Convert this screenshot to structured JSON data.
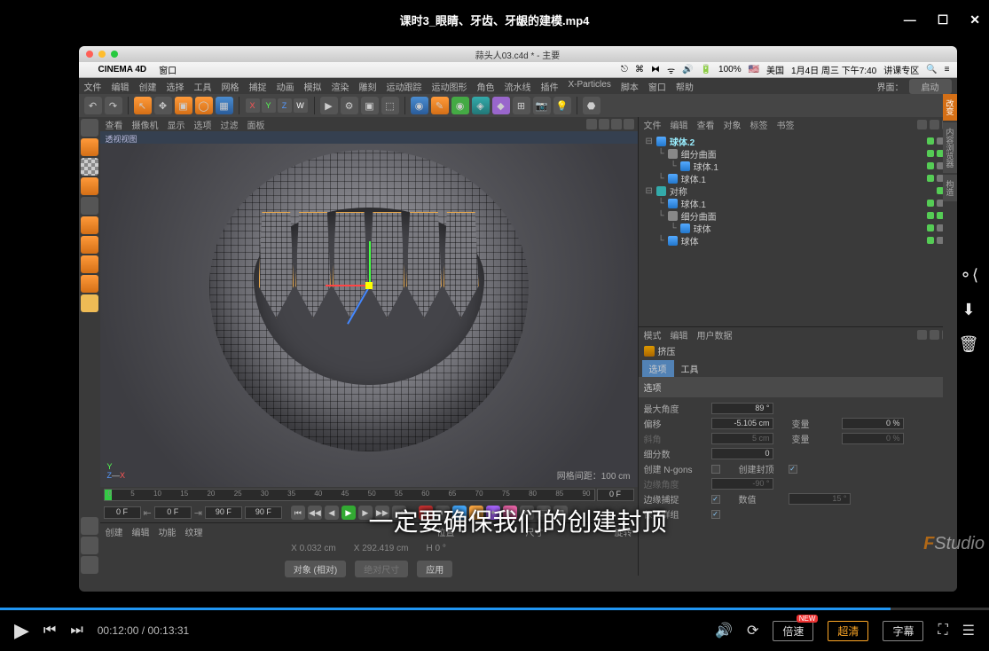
{
  "player": {
    "title": "课时3_眼睛、牙齿、牙龈的建模.mp4",
    "time_current": "00:12:00",
    "time_total": "00:13:31",
    "speed_label": "倍速",
    "quality_label": "超清",
    "subtitle_label": "字幕",
    "new_badge": "NEW",
    "subtitle_text": "一定要确保我们的创建封顶"
  },
  "mac": {
    "app": "CINEMA 4D",
    "menu": "窗口",
    "right": [
      "美国",
      "1月4日 周三 下午7:40",
      "讲课专区"
    ],
    "battery": "100%"
  },
  "window_title": "蒜头人03.c4d * - 主要",
  "c4d_menu": [
    "文件",
    "编辑",
    "创建",
    "选择",
    "工具",
    "网格",
    "捕捉",
    "动画",
    "模拟",
    "渲染",
    "雕刻",
    "运动跟踪",
    "运动图形",
    "角色",
    "流水线",
    "插件",
    "X-Particles",
    "脚本",
    "窗口",
    "帮助"
  ],
  "layout_label": "界面：",
  "layout_value": "启动",
  "axis": {
    "x": "X",
    "y": "Y",
    "z": "Z",
    "w": "W"
  },
  "viewport": {
    "menu": [
      "查看",
      "摄像机",
      "显示",
      "选项",
      "过滤",
      "面板"
    ],
    "label": "透视视图",
    "grid_info": "网格间距：100 cm"
  },
  "timeline": {
    "in1": "0 F",
    "in2": "0 F",
    "in3": "90 F",
    "in4": "90 F",
    "start": "0",
    "end": "90",
    "ticks": [
      "0",
      "5",
      "10",
      "15",
      "20",
      "25",
      "30",
      "35",
      "40",
      "45",
      "50",
      "55",
      "60",
      "65",
      "70",
      "75",
      "80",
      "85",
      "90"
    ],
    "end_label": "0 F"
  },
  "bottom_tabs": [
    "创建",
    "编辑",
    "功能",
    "纹理"
  ],
  "coord_headers": [
    "位置",
    "尺寸",
    "旋转"
  ],
  "coord_vals": {
    "x": "X 0.032 cm",
    "xw": "X 292.419 cm",
    "h": "H 0 °"
  },
  "apply_btns": {
    "mode": "对象 (相对)",
    "abs": "绝对尺寸",
    "apply": "应用"
  },
  "objmgr": {
    "tabs": [
      "文件",
      "编辑",
      "查看",
      "对象",
      "标签",
      "书签"
    ],
    "items": [
      {
        "indent": 0,
        "icon": "blue",
        "name": "球体.2",
        "current": true,
        "dots": [
          "g",
          "gr",
          "chk"
        ]
      },
      {
        "indent": 1,
        "icon": "grey",
        "name": "细分曲面",
        "dots": [
          "g",
          "g",
          "chk"
        ]
      },
      {
        "indent": 2,
        "icon": "blue",
        "name": "球体.1",
        "dots": [
          "g",
          "gr",
          "chk"
        ]
      },
      {
        "indent": 1,
        "icon": "blue",
        "name": "球体.1",
        "dots": [
          "g",
          "gr",
          "chk"
        ]
      },
      {
        "indent": 0,
        "icon": "teal",
        "name": "对称",
        "dots": [
          "g",
          "g"
        ]
      },
      {
        "indent": 1,
        "icon": "blue",
        "name": "球体.1",
        "dots": [
          "g",
          "gr",
          "chk"
        ]
      },
      {
        "indent": 1,
        "icon": "grey",
        "name": "细分曲面",
        "dots": [
          "g",
          "g",
          "chk"
        ]
      },
      {
        "indent": 2,
        "icon": "blue",
        "name": "球体",
        "dots": [
          "g",
          "gr",
          "chk"
        ]
      },
      {
        "indent": 1,
        "icon": "blue",
        "name": "球体",
        "dots": [
          "g",
          "gr",
          "chk"
        ]
      }
    ]
  },
  "attr": {
    "head": [
      "模式",
      "编辑",
      "用户数据"
    ],
    "tool_icon": "extrude",
    "tool_name": "挤压",
    "tabs": [
      "选项",
      "工具"
    ],
    "section": "选项",
    "rows": [
      {
        "l": "最大角度",
        "v": "89 °",
        "dim": false
      },
      {
        "l": "偏移",
        "v": "-5.105 cm",
        "dim": false,
        "l2": "变量",
        "v2": "0 %"
      },
      {
        "l": "斜角",
        "v": "5 cm",
        "dim": true,
        "l2": "变量",
        "v2": "0 %",
        "dim2": true
      },
      {
        "l": "细分数",
        "v": "0",
        "dim": false
      },
      {
        "l": "创建 N-gons",
        "chk": "",
        "l2": "创建封顶",
        "chk2": "✓"
      },
      {
        "l": "边缘角度",
        "v": "-90 °",
        "dim": true
      },
      {
        "l": "边缘捕捉",
        "chk": "✓",
        "l2": "数值",
        "v2": "15 °",
        "dim2": true
      },
      {
        "l": "保持群组",
        "chk": "✓"
      }
    ]
  },
  "side_tabs": [
    "改变",
    "内容浏览器",
    "构造"
  ],
  "logo_text": "Studio"
}
